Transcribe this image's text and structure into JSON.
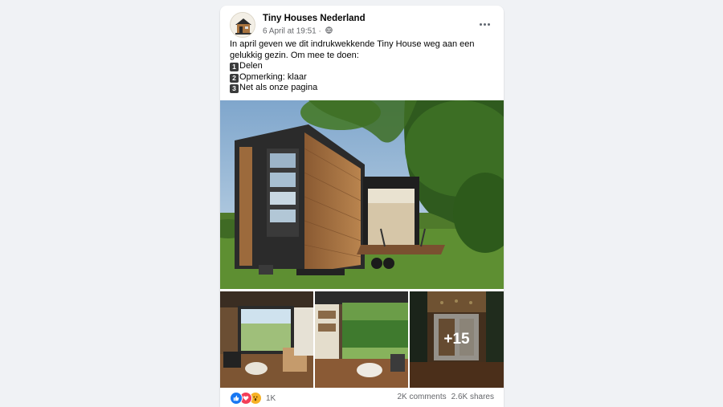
{
  "post": {
    "page_name": "Tiny Houses Nederland",
    "timestamp": "6 April at 19:51",
    "separator": "·",
    "privacy_icon": "globe-icon",
    "more_icon": "more-options-icon",
    "text_intro": "In april geven we dit indrukwekkende Tiny House weg aan een gelukkig gezin. Om mee te doen:",
    "steps": [
      {
        "number": "1",
        "label": "Delen"
      },
      {
        "number": "2",
        "label": "Opmerking: klaar"
      },
      {
        "number": "3",
        "label": "Net als onze pagina"
      }
    ]
  },
  "photos": {
    "main_alt": "tiny-house-exterior-photo",
    "thumb_alts": [
      "tiny-house-living-room",
      "tiny-house-open-wall",
      "tiny-house-interior-hall"
    ],
    "more_count": "+15"
  },
  "footer": {
    "reaction_icons": [
      "like-icon",
      "love-icon",
      "wow-icon"
    ],
    "reaction_count": "1K",
    "comments": "2K comments",
    "shares": "2.6K shares"
  },
  "colors": {
    "accent": "#1877f2",
    "love": "#f33e58",
    "wow": "#f7b125",
    "secondary_text": "#65676b",
    "page_background": "#f0f2f5"
  }
}
